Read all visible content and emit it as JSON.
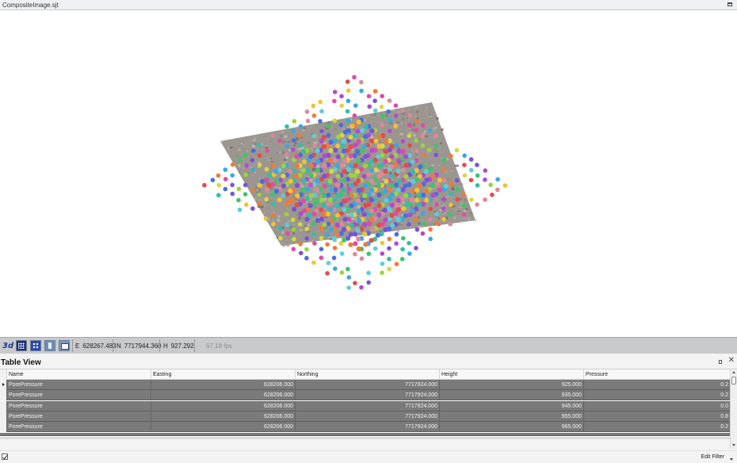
{
  "window": {
    "title": "CompositeImage.sjt"
  },
  "statusbar": {
    "easting_key": "E",
    "easting": "628267.483",
    "northing_key": "N",
    "northing": "7717944.360",
    "height_key": "H",
    "height": "927.292",
    "fps": "67.18 fps",
    "view3d_label": "3d"
  },
  "table_view": {
    "title": "Table View",
    "columns": [
      "Name",
      "Easting",
      "Northing",
      "Height",
      "Pressure"
    ],
    "rows": [
      [
        "PorePressure",
        "628206.000",
        "7717924.000",
        "925.000",
        "0.2"
      ],
      [
        "PorePressure",
        "628206.000",
        "7717924.000",
        "935.000",
        "0.2"
      ],
      [
        "PorePressure",
        "628206.000",
        "7717924.000",
        "945.000",
        "0.0"
      ],
      [
        "PorePressure",
        "628206.000",
        "7717924.000",
        "955.000",
        "0.8"
      ],
      [
        "PorePressure",
        "628206.000",
        "7717924.000",
        "965.000",
        "0.2"
      ]
    ],
    "edit_filter": "Edit Filter"
  },
  "scene": {
    "surface_colors": [
      "#9b9790",
      "#b2aea6",
      "#857f78",
      "#c4bfb6",
      "#6f6a64",
      "#a9a193"
    ],
    "point_colors": [
      "#e64a4a",
      "#f07a3a",
      "#f2c230",
      "#9ad43c",
      "#3cc46a",
      "#2fbfa8",
      "#3aa8e0",
      "#4a6ee0",
      "#7a52d8",
      "#b24ad0",
      "#e04aa8",
      "#d8d840",
      "#58d0d8",
      "#e08898"
    ]
  }
}
